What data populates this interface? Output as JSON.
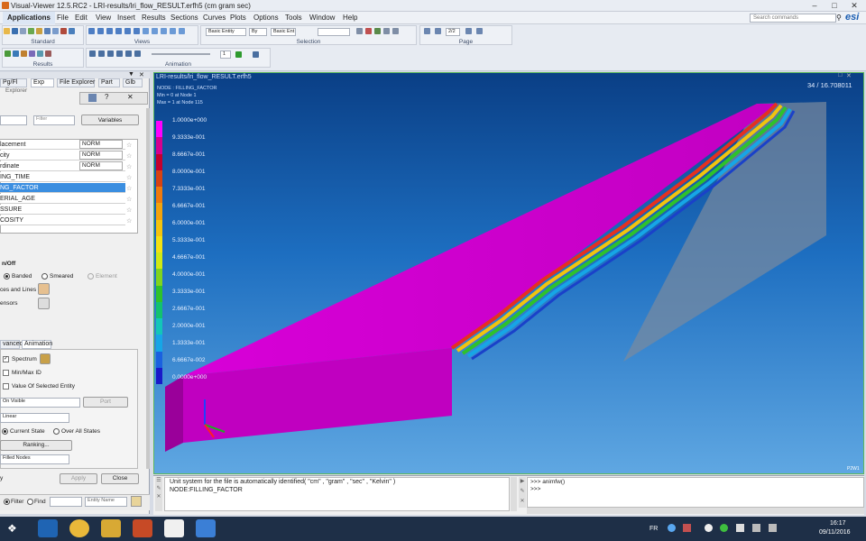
{
  "window": {
    "title": "Visual-Viewer 12.5.RC2 - LRI-results/lri_flow_RESULT.erfh5 (cm gram sec)"
  },
  "menu": [
    "Applications",
    "File",
    "Edit",
    "View",
    "Insert",
    "Results",
    "Sections",
    "Curves",
    "Plots",
    "Options",
    "Tools",
    "Window",
    "Help"
  ],
  "search": {
    "placeholder": "Search commands"
  },
  "brand": "esi",
  "toolbar": {
    "groups": [
      "Standard",
      "Views",
      "Selection",
      "Page",
      "Results",
      "Animation"
    ],
    "basic_entity": "Basic Entity",
    "by": "By",
    "basic_ent2": "Basic Ent",
    "page_no": "2/2",
    "anim_frame": "1"
  },
  "left_panel": {
    "tabs": [
      "Pg/Fl",
      "Exp",
      "File Explorer",
      "Part",
      "Glb"
    ],
    "explorer_label": "Explorer",
    "filter_placeholder": "Filter",
    "variables_button": "Variables",
    "variables": [
      {
        "name": "lacement",
        "mode": "NORM"
      },
      {
        "name": "city",
        "mode": "NORM"
      },
      {
        "name": "rdinate",
        "mode": "NORM"
      },
      {
        "name": "ING_TIME",
        "mode": ""
      },
      {
        "name": "NG_FACTOR",
        "mode": "",
        "selected": true
      },
      {
        "name": "ERIAL_AGE",
        "mode": ""
      },
      {
        "name": "SSURE",
        "mode": ""
      },
      {
        "name": "COSITY",
        "mode": ""
      }
    ],
    "on_off": "n/Off",
    "banded": "Banded",
    "smeared": "Smeared",
    "element": "Element",
    "ces_lines": "ces and Lines",
    "ensors": "ensors",
    "sub_tabs": [
      "vanced",
      "Animation"
    ],
    "spectrum": "Spectrum",
    "minmax": "Min/Max ID",
    "value_selected": "Value Of Selected Entity",
    "on_visible": "On Visible",
    "port": "Port",
    "linear": "Linear",
    "current_state": "Current State",
    "over_all_states": "Over All States",
    "ranking": "Ranking...",
    "filled_nodes": "Filled Nodes",
    "y_label": "y",
    "apply": "Apply",
    "close": "Close",
    "filter": "Filter",
    "find": "Find",
    "entity_name": "Entity Name"
  },
  "viewport": {
    "title": "LRI-results/lri_flow_RESULT.erfh5",
    "info": [
      "NODE : FILLING_FACTOR",
      "Min = 0 at Node 1",
      "Max = 1 at Node 115"
    ],
    "time": "34 / 16.708011",
    "corner_tag": "P2W1",
    "legend": [
      "1.0000e+000",
      "9.3333e-001",
      "8.6667e-001",
      "8.0000e-001",
      "7.3333e-001",
      "6.6667e-001",
      "6.0000e-001",
      "5.3333e-001",
      "4.6667e-001",
      "4.0000e-001",
      "3.3333e-001",
      "2.6667e-001",
      "2.0000e-001",
      "1.3333e-001",
      "6.6667e-002",
      "0.0000e+000"
    ],
    "legend_colors": [
      "#ff00ff",
      "#d5008f",
      "#c4002e",
      "#d64312",
      "#ee7a0d",
      "#f2a30c",
      "#f3c40e",
      "#f2e213",
      "#cfe915",
      "#7fd41e",
      "#2ec22b",
      "#12c26e",
      "#12c6b8",
      "#16a6e6",
      "#1a61e0",
      "#1919c9"
    ]
  },
  "console": {
    "left_lines": [
      "Unit system for the file is automatically identified( \"cm\" , \"gram\" , \"sec\" , \"Kelvin\" )",
      "NODE:FILLING_FACTOR"
    ],
    "right_lines": [
      ">>> animfw()",
      ">>>"
    ]
  },
  "taskbar": {
    "lang": "FR",
    "time": "16:17",
    "date": "09/11/2016"
  }
}
